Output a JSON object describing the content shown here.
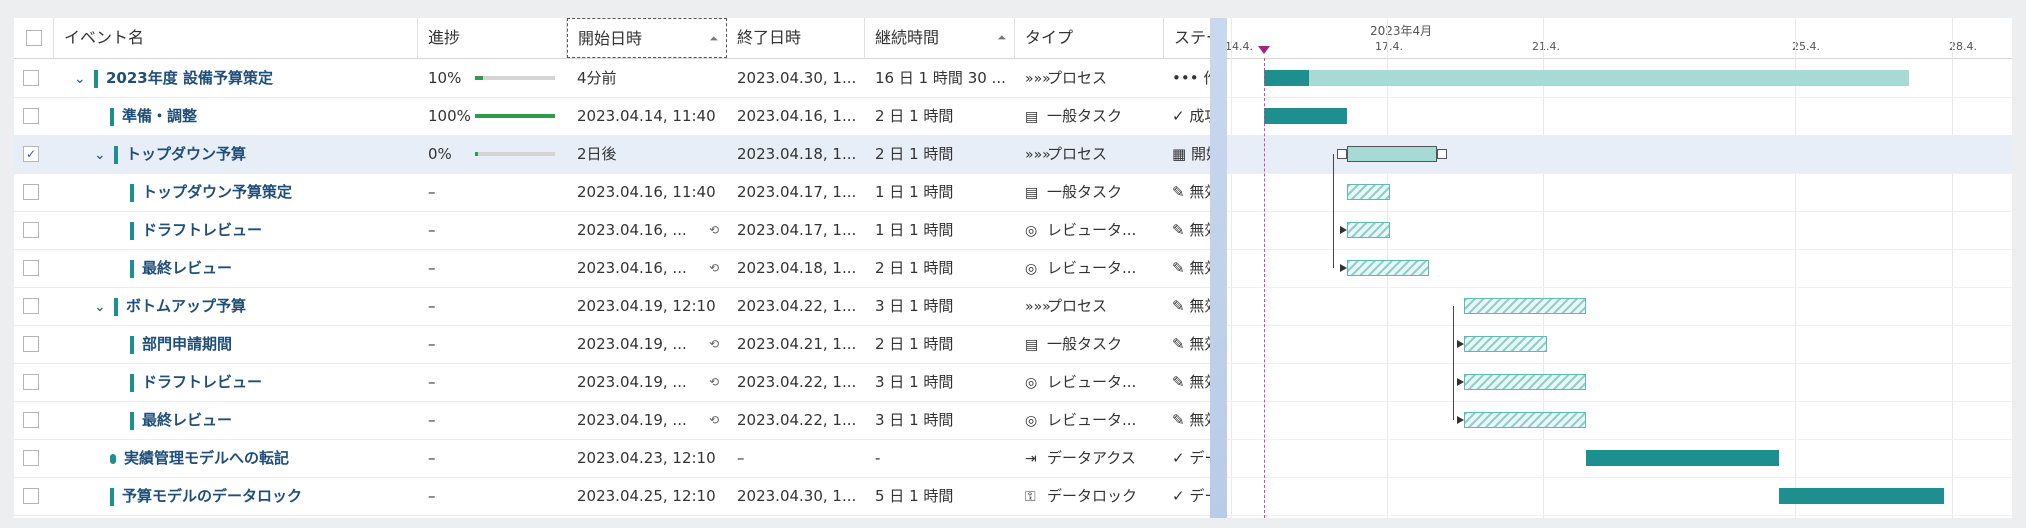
{
  "columns": {
    "name": "イベント名",
    "progress": "進捗",
    "start": "開始日時",
    "end": "終了日時",
    "duration": "継続時間",
    "type": "タイプ",
    "status": "ステー"
  },
  "rows": [
    {
      "name": "2023年度 設備予算策定",
      "level": 1,
      "expanded": true,
      "marker": "bar",
      "checked": false,
      "progress_text": "10%",
      "progress": 0.1,
      "show_bar": true,
      "start": "4分前",
      "link": false,
      "end": "2023.04.30, 1...",
      "duration": "16 日 1 時間 30 ...",
      "type_icon": "»»»",
      "type": "プロセス",
      "status_icon": "•••",
      "status": "作業"
    },
    {
      "name": "準備・調整",
      "level": 2,
      "expanded": null,
      "marker": "bar",
      "checked": false,
      "progress_text": "100%",
      "progress": 1.0,
      "show_bar": true,
      "start": "2023.04.14, 11:40",
      "link": false,
      "end": "2023.04.16, 1...",
      "duration": "2 日 1 時間",
      "type_icon": "▤",
      "type": "一般タスク",
      "status_icon": "✓",
      "status": "成功"
    },
    {
      "name": "トップダウン予算",
      "level": 2,
      "expanded": true,
      "marker": "bar",
      "checked": true,
      "progress_text": "0%",
      "progress": 0.0,
      "show_bar": true,
      "start": "2日後",
      "link": false,
      "end": "2023.04.18, 1...",
      "duration": "2 日 1 時間",
      "type_icon": "»»»",
      "type": "プロセス",
      "status_icon": "▦",
      "status": "開始"
    },
    {
      "name": "トップダウン予算策定",
      "level": 3,
      "expanded": null,
      "marker": "bar",
      "checked": false,
      "progress_text": "–",
      "progress": null,
      "show_bar": false,
      "start": "2023.04.16, 11:40",
      "link": false,
      "end": "2023.04.17, 1...",
      "duration": "1 日 1 時間",
      "type_icon": "▤",
      "type": "一般タスク",
      "status_icon": "✎",
      "status": "無効"
    },
    {
      "name": "ドラフトレビュー",
      "level": 3,
      "expanded": null,
      "marker": "bar",
      "checked": false,
      "progress_text": "–",
      "progress": null,
      "show_bar": false,
      "start": "2023.04.16, ...",
      "link": true,
      "end": "2023.04.17, 1...",
      "duration": "1 日 1 時間",
      "type_icon": "◎",
      "type": "レビュータ...",
      "status_icon": "✎",
      "status": "無効"
    },
    {
      "name": "最終レビュー",
      "level": 3,
      "expanded": null,
      "marker": "bar",
      "checked": false,
      "progress_text": "–",
      "progress": null,
      "show_bar": false,
      "start": "2023.04.16, ...",
      "link": true,
      "end": "2023.04.18, 1...",
      "duration": "2 日 1 時間",
      "type_icon": "◎",
      "type": "レビュータ...",
      "status_icon": "✎",
      "status": "無効"
    },
    {
      "name": "ボトムアップ予算",
      "level": 2,
      "expanded": true,
      "marker": "bar",
      "checked": false,
      "progress_text": "–",
      "progress": null,
      "show_bar": false,
      "start": "2023.04.19, 12:10",
      "link": false,
      "end": "2023.04.22, 1...",
      "duration": "3 日 1 時間",
      "type_icon": "»»»",
      "type": "プロセス",
      "status_icon": "✎",
      "status": "無効"
    },
    {
      "name": "部門申請期間",
      "level": 3,
      "expanded": null,
      "marker": "bar",
      "checked": false,
      "progress_text": "–",
      "progress": null,
      "show_bar": false,
      "start": "2023.04.19, ...",
      "link": true,
      "end": "2023.04.21, 1...",
      "duration": "2 日 1 時間",
      "type_icon": "▤",
      "type": "一般タスク",
      "status_icon": "✎",
      "status": "無効"
    },
    {
      "name": "ドラフトレビュー",
      "level": 3,
      "expanded": null,
      "marker": "bar",
      "checked": false,
      "progress_text": "–",
      "progress": null,
      "show_bar": false,
      "start": "2023.04.19, ...",
      "link": true,
      "end": "2023.04.22, 1...",
      "duration": "3 日 1 時間",
      "type_icon": "◎",
      "type": "レビュータ...",
      "status_icon": "✎",
      "status": "無効"
    },
    {
      "name": "最終レビュー",
      "level": 3,
      "expanded": null,
      "marker": "bar",
      "checked": false,
      "progress_text": "–",
      "progress": null,
      "show_bar": false,
      "start": "2023.04.19, ...",
      "link": true,
      "end": "2023.04.22, 1...",
      "duration": "3 日 1 時間",
      "type_icon": "◎",
      "type": "レビュータ...",
      "status_icon": "✎",
      "status": "無効"
    },
    {
      "name": "実績管理モデルへの転記",
      "level": 2,
      "expanded": null,
      "marker": "dot",
      "checked": false,
      "progress_text": "–",
      "progress": null,
      "show_bar": false,
      "start": "2023.04.23, 12:10",
      "link": false,
      "end": "–",
      "duration": "-",
      "type_icon": "⇥",
      "type": "データアクス",
      "status_icon": "✓",
      "status": "デー"
    },
    {
      "name": "予算モデルのデータロック",
      "level": 2,
      "expanded": null,
      "marker": "bar",
      "checked": false,
      "progress_text": "–",
      "progress": null,
      "show_bar": false,
      "start": "2023.04.25, 12:10",
      "link": false,
      "end": "2023.04.30, 1...",
      "duration": "5 日 1 時間",
      "type_icon": "⚿",
      "type": "データロック",
      "status_icon": "✓",
      "status": "デー"
    }
  ],
  "gantt": {
    "month_label": "2023年4月",
    "dates": [
      "14.4.",
      "17.4.",
      "21.4.",
      "25.4.",
      "28.4."
    ],
    "tasks": [
      {
        "style": "light",
        "solid_fraction": 0.1,
        "start_day": 14.0,
        "end_day": 30.4
      },
      {
        "style": "solid",
        "start_day": 14.0,
        "end_day": 16.1
      },
      {
        "style": "summary",
        "start_day": 16.1,
        "end_day": 18.4
      },
      {
        "style": "hatch",
        "start_day": 16.1,
        "end_day": 17.2
      },
      {
        "style": "hatch",
        "start_day": 16.1,
        "end_day": 17.2
      },
      {
        "style": "hatch",
        "start_day": 16.1,
        "end_day": 18.2
      },
      {
        "style": "hatch",
        "start_day": 19.1,
        "end_day": 22.2
      },
      {
        "style": "hatch",
        "start_day": 19.1,
        "end_day": 21.2
      },
      {
        "style": "hatch",
        "start_day": 19.1,
        "end_day": 22.2
      },
      {
        "style": "hatch",
        "start_day": 19.1,
        "end_day": 22.2
      },
      {
        "style": "solid",
        "start_day": 22.2,
        "end_day": 27.1
      },
      {
        "style": "solid",
        "start_day": 27.1,
        "end_day": 31.3
      }
    ],
    "marker_day": 14.0,
    "colors": {
      "bar": "#1e8f8f",
      "light": "#a7d9d5",
      "marker": "#c64fa7"
    }
  }
}
